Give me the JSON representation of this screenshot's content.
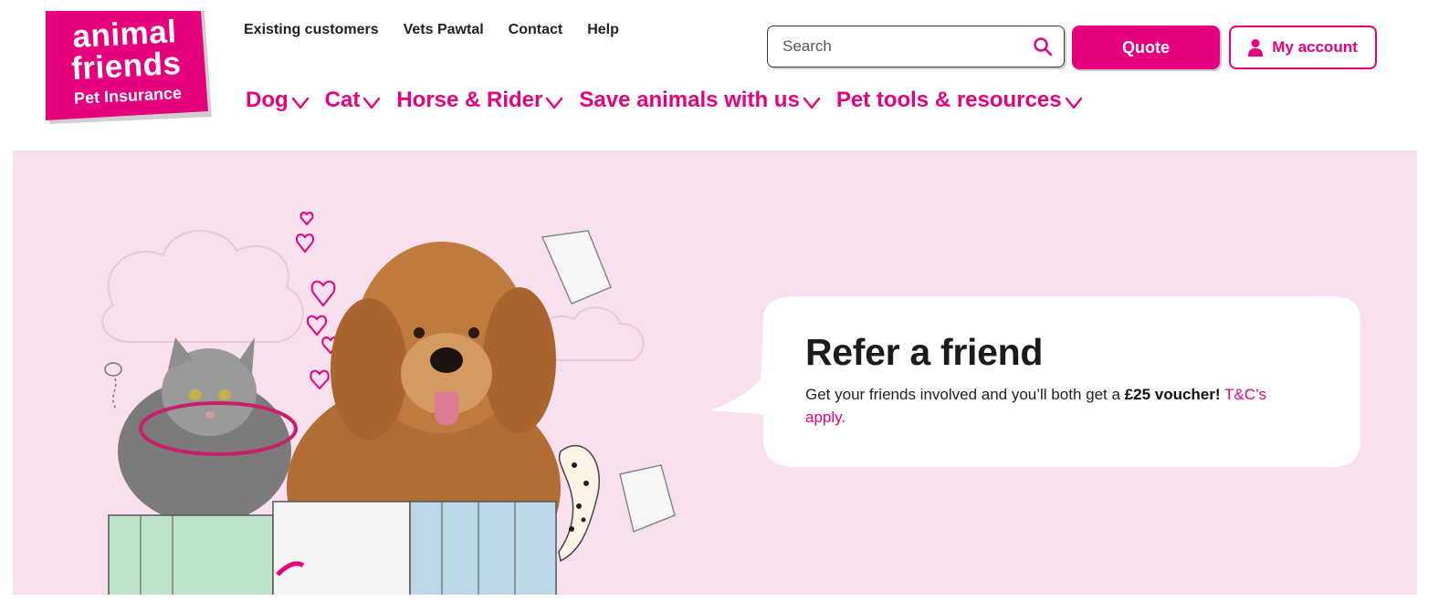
{
  "brand": {
    "logo_line1": "animal",
    "logo_line2": "friends",
    "logo_line3": "Pet Insurance",
    "primary_color": "#e6007e",
    "hero_background": "#f8e0ee"
  },
  "top_links": [
    "Existing customers",
    "Vets Pawtal",
    "Contact",
    "Help"
  ],
  "main_nav": [
    "Dog",
    "Cat",
    "Horse & Rider",
    "Save animals with us",
    "Pet tools & resources"
  ],
  "search": {
    "placeholder": "Search",
    "icon": "search-icon"
  },
  "quote_label": "Quote",
  "account_label": "My account",
  "hero": {
    "title": "Refer a friend",
    "text_before": "Get your friends involved and you’ll both get a ",
    "text_bold": "£25 voucher!",
    "link_text": "T&C’s apply."
  }
}
